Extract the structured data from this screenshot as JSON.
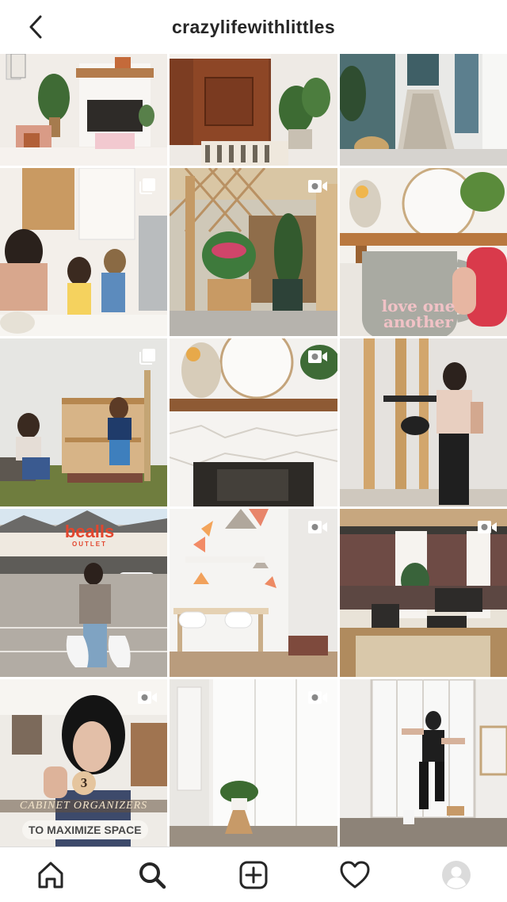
{
  "header": {
    "title": "crazylifewithlittles",
    "back_icon": "chevron-left-icon"
  },
  "posts": [
    {
      "id": 1,
      "scene": "living room with white brick fireplace and wood mantel",
      "badge": null
    },
    {
      "id": 2,
      "scene": "wooden front door with plants and striped rug",
      "badge": null
    },
    {
      "id": 3,
      "scene": "hallway with blue wall and runner rug",
      "badge": null
    },
    {
      "id": 4,
      "scene": "kitchen with mom and kids",
      "badge": "carousel-icon"
    },
    {
      "id": 5,
      "scene": "backyard pergola with planters",
      "badge": "video-icon"
    },
    {
      "id": 6,
      "scene": "mug on mantel",
      "badge": null,
      "mug_text_line1": "love one",
      "mug_text_line2": "another"
    },
    {
      "id": 7,
      "scene": "kids at outdoor play kitchen",
      "badge": "carousel-icon"
    },
    {
      "id": 8,
      "scene": "white stone fireplace with round mirror",
      "badge": "video-icon"
    },
    {
      "id": 9,
      "scene": "woman holding shelf in garage",
      "badge": null
    },
    {
      "id": 10,
      "scene": "bealls outlet store parking lot",
      "badge": null,
      "sign_line1": "bealls",
      "sign_line2": "OUTLET"
    },
    {
      "id": 11,
      "scene": "geometric painted wall desk area",
      "badge": "video-icon"
    },
    {
      "id": 12,
      "scene": "screened patio with furniture",
      "badge": "video-icon"
    },
    {
      "id": 13,
      "scene": "woman talking in kitchen",
      "badge": "video-icon",
      "number": "3",
      "overlay_line1": "CABINET ORGANIZERS",
      "overlay_line2": "TO MAXIMIZE SPACE"
    },
    {
      "id": 14,
      "scene": "white wardrobe with plant",
      "badge": "video-icon"
    },
    {
      "id": 15,
      "scene": "woman painting closet doors",
      "badge": null
    }
  ],
  "nav": {
    "items": [
      "home-icon",
      "search-icon",
      "new-post-icon",
      "activity-heart-icon",
      "profile-avatar-icon"
    ],
    "active": "search-icon"
  },
  "colors": {
    "text": "#262626",
    "border": "#dbdbdb",
    "background": "#ffffff"
  }
}
